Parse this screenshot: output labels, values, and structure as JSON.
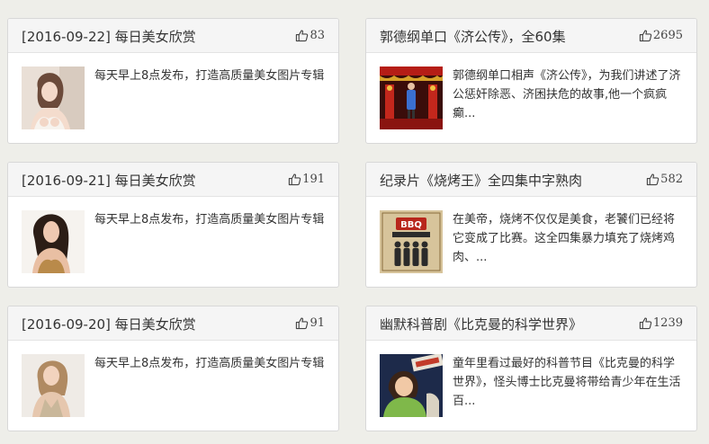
{
  "cards": [
    {
      "title": "[2016-09-22] 每日美女欣赏",
      "likes": "83",
      "desc": "每天早上8点发布，打造高质量美女图片专辑",
      "thumb": "portrait-photo"
    },
    {
      "title": "郭德纲单口《济公传》，全60集",
      "likes": "2695",
      "desc": "郭德纲单口相声《济公传》，为我们讲述了济公惩奸除恶、济困扶危的故事,他一个疯疯癫...",
      "thumb": "stage-photo"
    },
    {
      "title": "[2016-09-21] 每日美女欣赏",
      "likes": "191",
      "desc": "每天早上8点发布，打造高质量美女图片专辑",
      "thumb": "portrait-photo"
    },
    {
      "title": "纪录片《烧烤王》全四集中字熟肉",
      "likes": "582",
      "desc": "在美帝，烧烤不仅仅是美食，老饕们已经将它变成了比赛。这全四集暴力填充了烧烤鸡肉、...",
      "thumb": "bbq-poster",
      "thumb_text": "BBQ"
    },
    {
      "title": "[2016-09-20] 每日美女欣赏",
      "likes": "91",
      "desc": "每天早上8点发布，打造高质量美女图片专辑",
      "thumb": "portrait-photo"
    },
    {
      "title": "幽默科普剧《比克曼的科学世界》",
      "likes": "1239",
      "desc": "童年里看过最好的科普节目《比克曼的科学世界》，怪头博士比克曼将带给青少年在生活百...",
      "thumb": "tv-show-photo"
    }
  ],
  "icons": {
    "like": "thumbs-up-icon"
  },
  "colors": {
    "background": "#eeeee9",
    "header": "#f5f5f5",
    "border": "#d8d8d8"
  }
}
